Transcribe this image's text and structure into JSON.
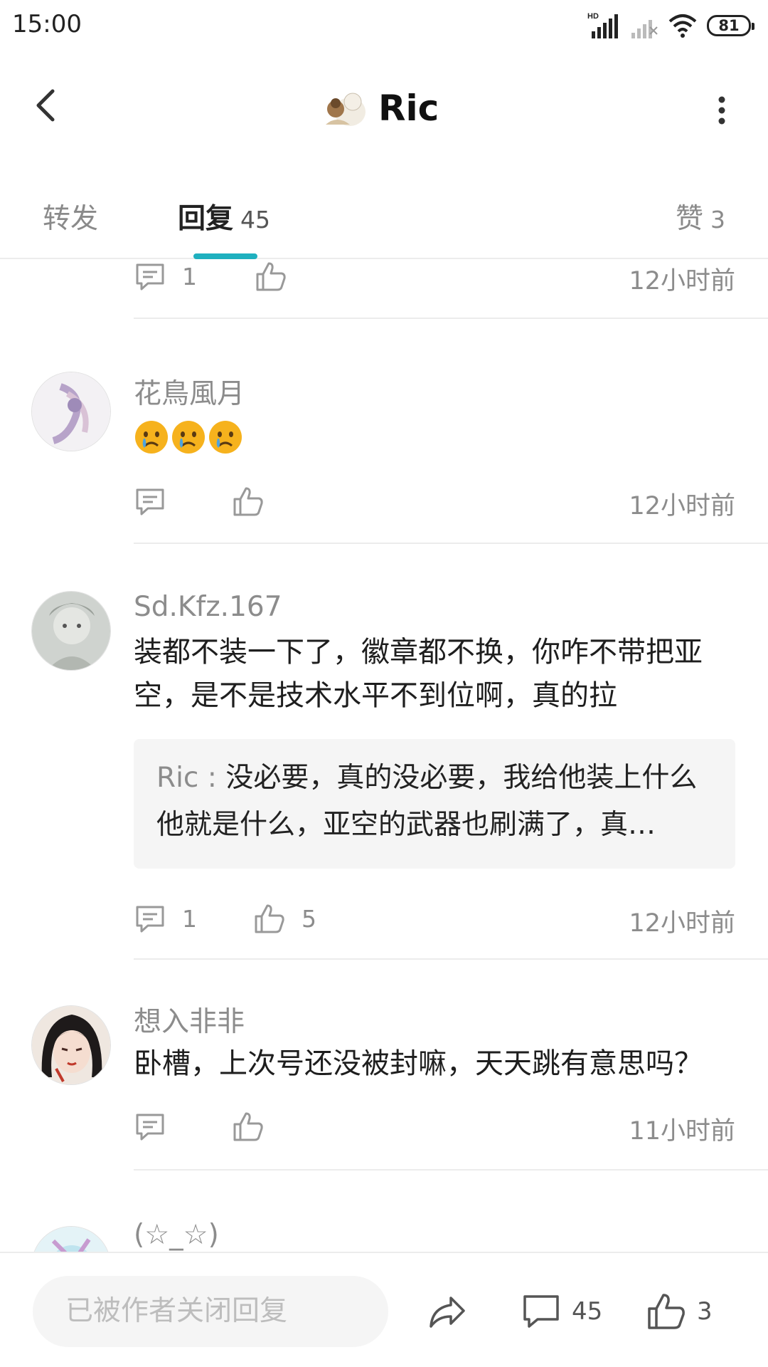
{
  "status_bar": {
    "time": "15:00",
    "battery": "81",
    "network_label": "HD"
  },
  "header": {
    "title": "Ric"
  },
  "tabs": [
    {
      "label": "转发",
      "count": ""
    },
    {
      "label": "回复",
      "count": "45"
    },
    {
      "label": "赞",
      "count": "3"
    }
  ],
  "comments": [
    {
      "comment_count": "1",
      "like_count": "",
      "time": "12小时前"
    },
    {
      "name": "花鳥風月",
      "content": "😢😢😢",
      "comment_count": "",
      "like_count": "",
      "time": "12小时前"
    },
    {
      "name": "Sd.Kfz.167",
      "content": "装都不装一下了，徽章都不换，你咋不带把亚空，是不是技术水平不到位啊，真的拉",
      "quote_name": "Ric",
      "quote_sep": " : ",
      "quote_text": "没必要，真的没必要，我给他装上什么他就是什么，亚空的武器也刷满了，真…",
      "comment_count": "1",
      "like_count": "5",
      "time": "12小时前"
    },
    {
      "name": "想入非非",
      "content": "卧槽，上次号还没被封嘛，天天跳有意思吗？",
      "comment_count": "",
      "like_count": "",
      "time": "11小时前"
    },
    {
      "name": "(☆_☆)"
    }
  ],
  "bottom_bar": {
    "input_placeholder": "已被作者关闭回复",
    "comment_count": "45",
    "like_count": "3"
  },
  "colors": {
    "accent": "#1fb0bf",
    "muted": "#8c8c8c",
    "divider": "#ececec"
  },
  "icons": [
    "back-arrow-icon",
    "more-icon",
    "comment-icon",
    "thumbs-up-icon",
    "share-icon",
    "crying-face-emoji"
  ]
}
